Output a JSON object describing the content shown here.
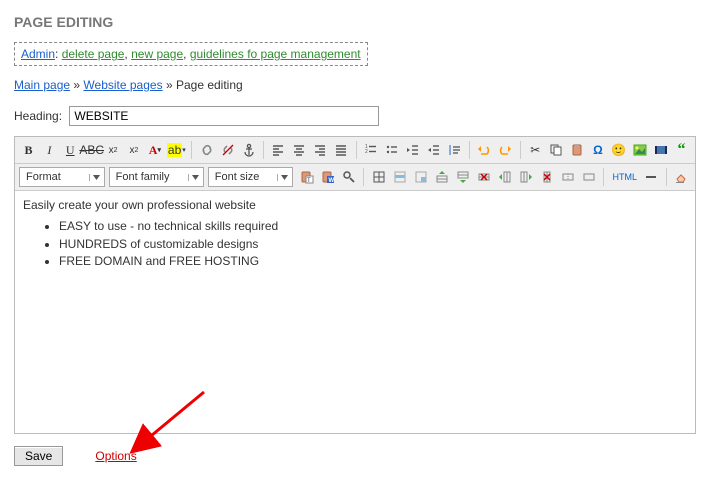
{
  "page_title": "PAGE EDITING",
  "admin_bar": {
    "admin_label": "Admin",
    "delete_page": "delete page",
    "new_page": "new page",
    "guidelines": "guidelines fo page management"
  },
  "breadcrumb": {
    "main": "Main page",
    "pages": "Website pages",
    "sep": "»",
    "current": "Page editing"
  },
  "heading": {
    "label": "Heading:",
    "value": "WEBSITE"
  },
  "dropdowns": {
    "format": "Format",
    "font_family": "Font family",
    "font_size": "Font size"
  },
  "html_label": "HTML",
  "content": {
    "line": "Easily create your own professional website",
    "bullets": [
      "EASY to use - no technical skills required",
      "HUNDREDS of customizable designs",
      "FREE DOMAIN and FREE HOSTING"
    ]
  },
  "footer": {
    "save": "Save",
    "options": "Options"
  }
}
